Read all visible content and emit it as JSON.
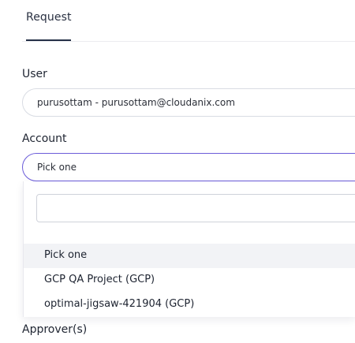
{
  "tabs": {
    "request": "Request"
  },
  "user": {
    "label": "User",
    "value": "purusottam - purusottam@cloudanix.com"
  },
  "account": {
    "label": "Account",
    "value": "Pick one",
    "search_placeholder": "",
    "options": [
      {
        "label": "Pick one",
        "selected": true
      },
      {
        "label": "GCP QA Project (GCP)",
        "selected": false
      },
      {
        "label": "optimal-jigsaw-421904 (GCP)",
        "selected": false
      }
    ]
  },
  "approvers": {
    "label": "Approver(s)"
  },
  "colors": {
    "focus_border": "#6b5cd9",
    "tab_underline": "#253047",
    "selected_option_bg": "#f2f3f6"
  }
}
